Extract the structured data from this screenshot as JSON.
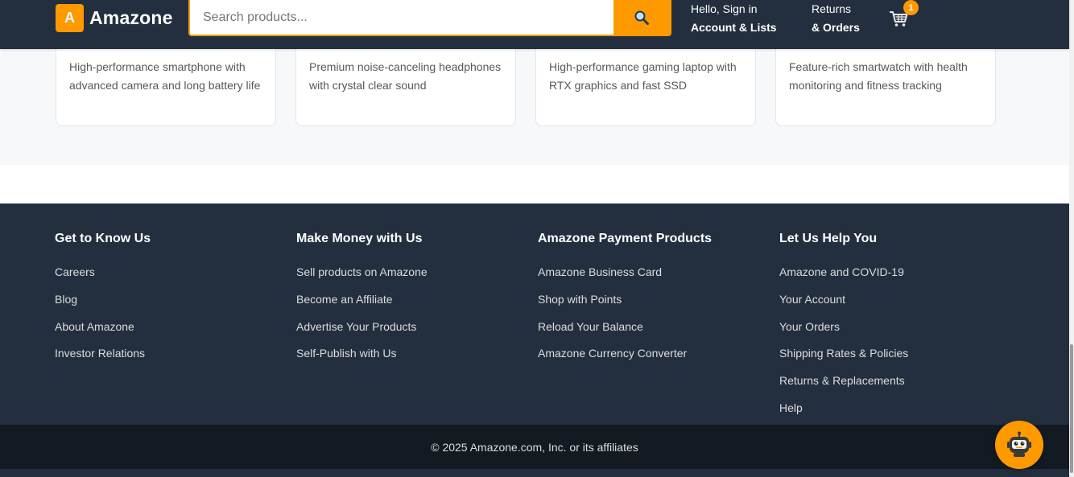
{
  "header": {
    "logo_letter": "A",
    "logo_text": "Amazone",
    "search": {
      "placeholder": "Search products...",
      "value": ""
    },
    "account": {
      "line1": "Hello, Sign in",
      "line2": "Account & Lists"
    },
    "orders": {
      "line1": "Returns",
      "line2": "& Orders"
    },
    "cart_count": "1"
  },
  "products": [
    {
      "description": "High-performance smartphone with advanced camera and long battery life"
    },
    {
      "description": "Premium noise-canceling headphones with crystal clear sound"
    },
    {
      "description": "High-performance gaming laptop with RTX graphics and fast SSD"
    },
    {
      "description": "Feature-rich smartwatch with health monitoring and fitness tracking"
    }
  ],
  "footer": {
    "columns": [
      {
        "title": "Get to Know Us",
        "links": [
          "Careers",
          "Blog",
          "About Amazone",
          "Investor Relations"
        ]
      },
      {
        "title": "Make Money with Us",
        "links": [
          "Sell products on Amazone",
          "Become an Affiliate",
          "Advertise Your Products",
          "Self-Publish with Us"
        ]
      },
      {
        "title": "Amazone Payment Products",
        "links": [
          "Amazone Business Card",
          "Shop with Points",
          "Reload Your Balance",
          "Amazone Currency Converter"
        ]
      },
      {
        "title": "Let Us Help You",
        "links": [
          "Amazone and COVID-19",
          "Your Account",
          "Your Orders",
          "Shipping Rates & Policies",
          "Returns & Replacements",
          "Help"
        ]
      }
    ],
    "copyright": "© 2025 Amazone.com, Inc. or its affiliates"
  },
  "colors": {
    "header_bg": "#232f3e",
    "accent": "#ff9900",
    "footer_bottom_bg": "#131a22"
  },
  "icons": {
    "search": "search-icon",
    "cart": "cart-icon",
    "chatbot": "robot-icon"
  }
}
